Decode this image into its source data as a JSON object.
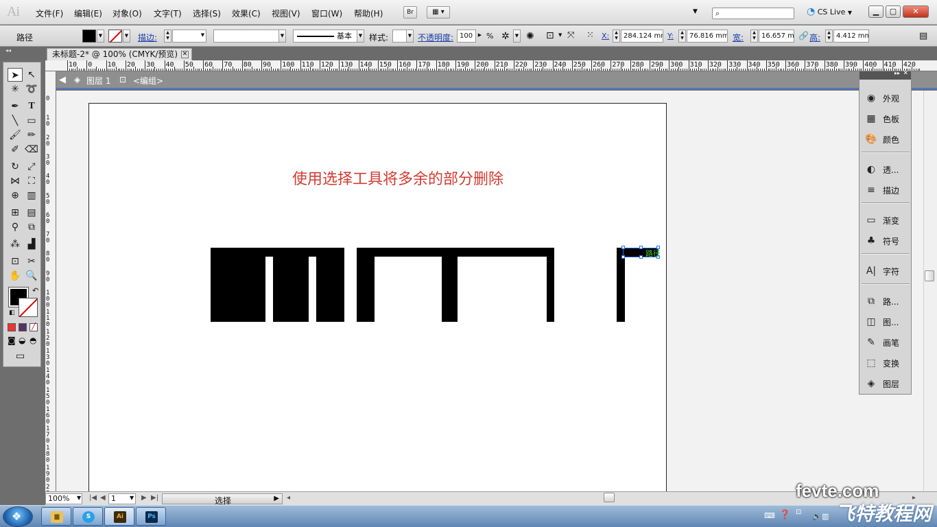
{
  "menubar": {
    "logo": "Ai",
    "items": [
      "文件(F)",
      "编辑(E)",
      "对象(O)",
      "文字(T)",
      "选择(S)",
      "效果(C)",
      "视图(V)",
      "窗口(W)",
      "帮助(H)"
    ],
    "bridge_label": "Br",
    "cs_live": "CS Live"
  },
  "controlbar": {
    "object_type": "路径",
    "stroke_label": "描边:",
    "brush_style_label": "基本",
    "style_label": "样式:",
    "opacity_label": "不透明度:",
    "opacity_value": "100",
    "opacity_unit": "%",
    "x_label": "X:",
    "x_value": "284.124 mm",
    "y_label": "Y:",
    "y_value": "76.816 mm",
    "w_label": "宽:",
    "w_value": "16.657 mm",
    "h_label": "高:",
    "h_value": "4.412 mm"
  },
  "document": {
    "tab_title": "未标题-2* @ 100% (CMYK/预览)",
    "layer_name": "图层 1",
    "group_name": "<编组>",
    "instruction_text": "使用选择工具将多余的部分删除",
    "path_label": "路径"
  },
  "ruler": {
    "h_labels": [
      "10",
      "0",
      "10",
      "20",
      "30",
      "40",
      "50",
      "60",
      "70",
      "80",
      "90",
      "100",
      "110",
      "120",
      "130",
      "140",
      "150",
      "160",
      "170",
      "180",
      "190",
      "200",
      "210",
      "220",
      "230",
      "240",
      "250",
      "260",
      "270",
      "280",
      "290",
      "300",
      "310",
      "320",
      "330",
      "340",
      "350",
      "360",
      "370",
      "380",
      "390",
      "400",
      "410",
      "420"
    ],
    "v_labels": [
      "0",
      "1 0",
      "2 0",
      "3 0",
      "4 0",
      "5 0",
      "6 0",
      "7 0",
      "8 0",
      "9 0",
      "1 0 0",
      "1 1 0",
      "1 2 0",
      "1 3 0",
      "1 4 0",
      "1 5 0",
      "1 6 0",
      "1 7 0",
      "1 8 0",
      "1 9 0",
      "2 0 0"
    ]
  },
  "statusbar": {
    "zoom": "100%",
    "page": "1",
    "tool_status": "选择"
  },
  "panels": [
    {
      "label": "外观",
      "icon": "appearance-icon",
      "glyph": "◉"
    },
    {
      "label": "色板",
      "icon": "swatches-icon",
      "glyph": "▦"
    },
    {
      "label": "颜色",
      "icon": "color-icon",
      "glyph": "🎨"
    },
    {
      "label": "透...",
      "icon": "transparency-icon",
      "glyph": "◐"
    },
    {
      "label": "描边",
      "icon": "stroke-icon",
      "glyph": "≡"
    },
    {
      "label": "渐变",
      "icon": "gradient-icon",
      "glyph": "▭"
    },
    {
      "label": "符号",
      "icon": "symbols-icon",
      "glyph": "♣"
    },
    {
      "label": "字符",
      "icon": "character-icon",
      "glyph": "A|"
    },
    {
      "label": "路...",
      "icon": "pathfinder-icon",
      "glyph": "⧉"
    },
    {
      "label": "图...",
      "icon": "graphic-styles-icon",
      "glyph": "◫"
    },
    {
      "label": "画笔",
      "icon": "brushes-icon",
      "glyph": "✎"
    },
    {
      "label": "变换",
      "icon": "transform-icon",
      "glyph": "⬚"
    },
    {
      "label": "图层",
      "icon": "layers-icon",
      "glyph": "◈"
    }
  ],
  "taskbar": {
    "ai_label": "Ai",
    "ps_label": "Ps",
    "watermark_site": "fevte.com",
    "watermark_cn": "飞特教程网"
  },
  "colors": {
    "instruction": "#d23b31",
    "selection": "#2b6cff",
    "path_label": "#44c844"
  }
}
